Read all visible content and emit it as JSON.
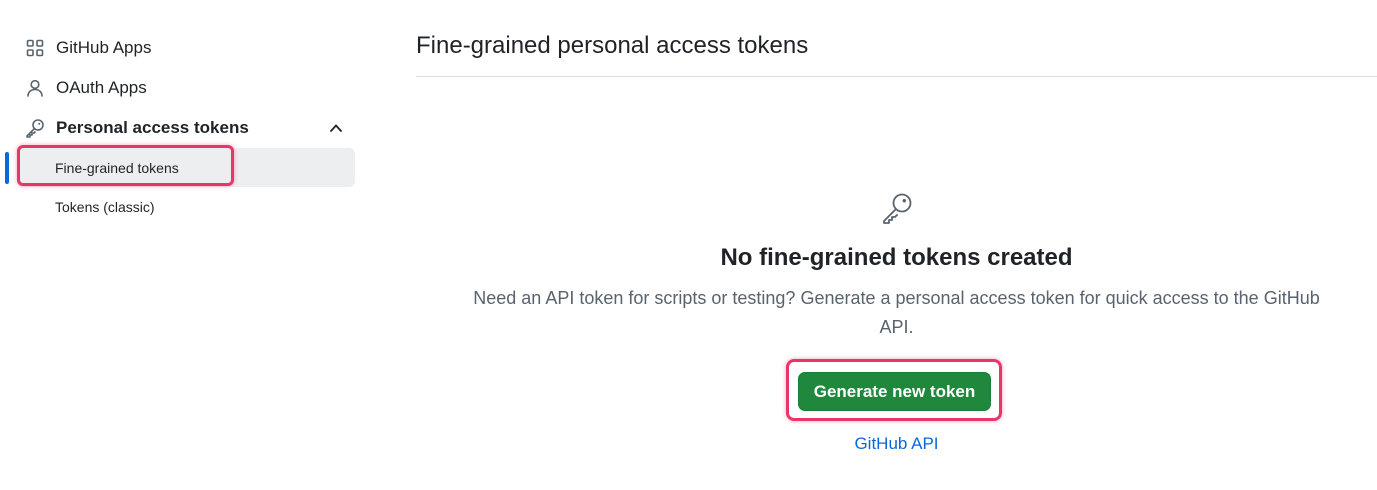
{
  "sidebar": {
    "items": [
      {
        "label": "GitHub Apps",
        "icon": "apps-grid-icon"
      },
      {
        "label": "OAuth Apps",
        "icon": "person-icon"
      },
      {
        "label": "Personal access tokens",
        "icon": "key-icon"
      }
    ],
    "sub_items": [
      {
        "label": "Fine-grained tokens",
        "active": true
      },
      {
        "label": "Tokens (classic)",
        "active": false
      }
    ]
  },
  "main": {
    "title": "Fine-grained personal access tokens",
    "blank_state": {
      "icon": "key-icon",
      "title": "No fine-grained tokens created",
      "description": "Need an API token for scripts or testing? Generate a personal access token for quick access to the GitHub API.",
      "button_label": "Generate new token",
      "link_label": "GitHub API"
    }
  },
  "colors": {
    "accent_blue": "#0969da",
    "button_green": "#1f883d",
    "highlight": "#e8366a"
  }
}
